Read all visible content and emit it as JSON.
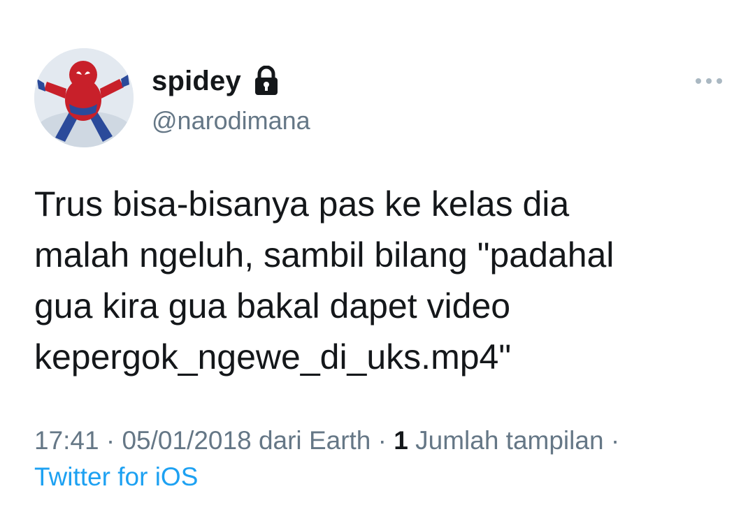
{
  "user": {
    "display_name": "spidey",
    "handle": "@narodimana",
    "protected_icon": "lock-icon",
    "avatar_icon": "spiderman-figure-avatar"
  },
  "more_icon": "more-horizontal-icon",
  "tweet": {
    "text": "Trus bisa-bisanya pas ke kelas dia\nmalah ngeluh, sambil bilang \"padahal\ngua kira gua bakal dapet video\nkepergok_ngewe_di_uks.mp4\""
  },
  "meta": {
    "time": "17:41",
    "separator": "·",
    "date": "05/01/2018",
    "location_prefix": "dari",
    "location": "Earth",
    "views_count": "1",
    "views_label": "Jumlah tampilan",
    "source": "Twitter for iOS"
  },
  "colors": {
    "text_primary": "#14171a",
    "text_secondary": "#657786",
    "link": "#1da1f2"
  }
}
